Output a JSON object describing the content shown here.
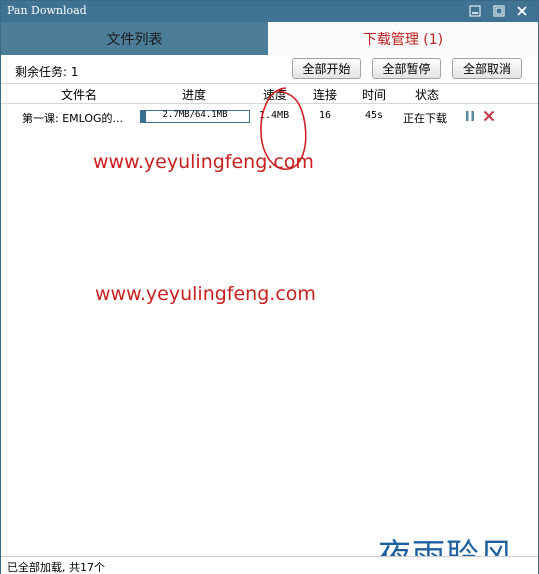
{
  "window": {
    "title": "Pan Download"
  },
  "tabs": [
    {
      "label": "文件列表"
    },
    {
      "label": "下载管理 (1)"
    }
  ],
  "toolbar": {
    "remaining": "剩余任务: 1",
    "start_all": "全部开始",
    "pause_all": "全部暂停",
    "cancel_all": "全部取消"
  },
  "columns": {
    "name": "文件名",
    "progress": "进度",
    "speed": "速度",
    "connections": "连接",
    "time": "时间",
    "status": "状态"
  },
  "downloads": [
    {
      "name": "第一课: EMLOG的...",
      "progress_text": "2.7MB/64.1MB",
      "progress_fraction": 0.042,
      "speed": "1.4MB",
      "connections": "16",
      "time": "45s",
      "status": "正在下载"
    }
  ],
  "watermark": {
    "url_1": "www.yeyulingfeng.com",
    "url_2": "www.yeyulingfeng.com",
    "brand": "夜雨聆风"
  },
  "statusbar": {
    "text": "已全部加载, 共17个"
  },
  "colors": {
    "titlebar": "#3f7391",
    "active_tab_text": "#c0201e",
    "progress": "#3b6f8e",
    "annotation_red": "#c91f1f",
    "brand_blue": "#1e5f9e"
  }
}
